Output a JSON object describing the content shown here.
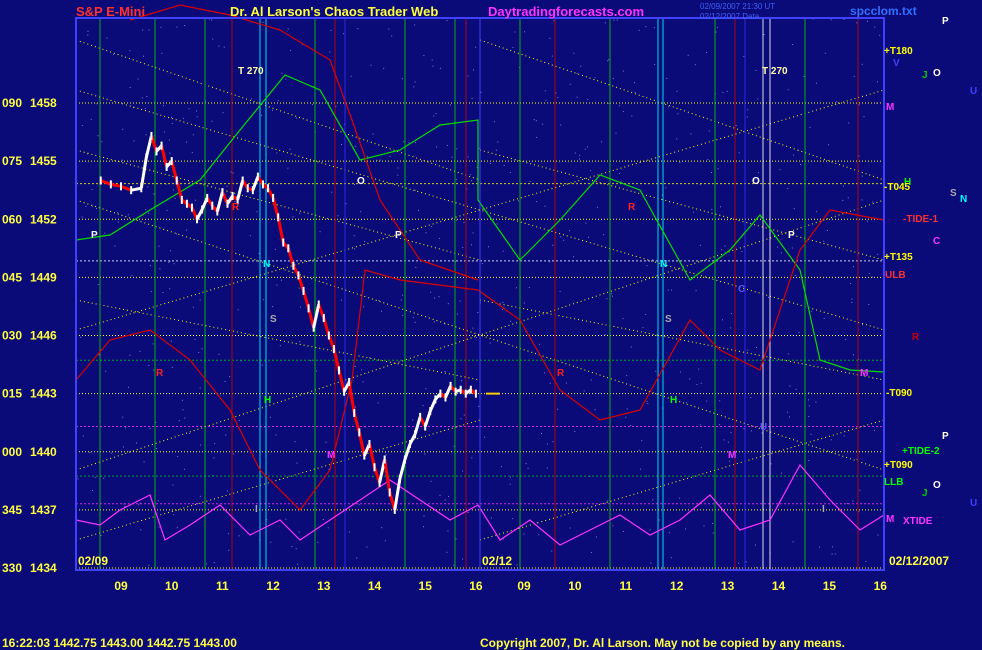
{
  "header": {
    "instrument": "S&P E-Mini",
    "site_title": "Dr. Al Larson's Chaos Trader Web",
    "site_url": "Daytradingforecasts.com",
    "stamp_line1": "02/09/2007 21:30 UT",
    "stamp_line2": "02/12/2007 Data",
    "file_name": "spcclom.txt"
  },
  "footer": {
    "quote_line": "16:22:03  1442.75  1443.00  1442.75  1443.00",
    "copyright": "Copyright 2007, Dr. Al Larson. May not be copied by any means."
  },
  "colors": {
    "background": "#0a0a78",
    "price_bar_up": "#ffffff",
    "price_bar_down": "#ff0000",
    "grid_dotted": "#ffff00",
    "vertical_green": "#00cc00",
    "vertical_red": "#cc0000",
    "vertical_cyan": "#00ffff",
    "vertical_blue": "#3030ff",
    "tide_green": "#00dd00",
    "tide_red": "#dd0000",
    "xtide_magenta": "#ff33ff",
    "axis_blue": "#4040ff"
  },
  "chart_data": {
    "type": "line",
    "title": "S&P E-Mini",
    "y_labels": [
      {
        "angle": "090",
        "price": "1458",
        "value": 1458
      },
      {
        "angle": "075",
        "price": "1455",
        "value": 1455
      },
      {
        "angle": "060",
        "price": "1452",
        "value": 1452
      },
      {
        "angle": "045",
        "price": "1449",
        "value": 1449
      },
      {
        "angle": "030",
        "price": "1446",
        "value": 1446
      },
      {
        "angle": "015",
        "price": "1443",
        "value": 1443
      },
      {
        "angle": "000",
        "price": "1440",
        "value": 1440
      },
      {
        "angle": "345",
        "price": "1437",
        "value": 1437
      },
      {
        "angle": "330",
        "price": "1434",
        "value": 1434
      }
    ],
    "ylim": [
      1434,
      1458
    ],
    "day1_date": "02/09",
    "day2_date": "02/12",
    "end_date": "02/12/2007",
    "day1_hours": [
      "09",
      "10",
      "11",
      "12",
      "13",
      "14",
      "15",
      "16"
    ],
    "day2_hours": [
      "09",
      "10",
      "11",
      "12",
      "13",
      "14",
      "15",
      "16"
    ],
    "price_series": {
      "name": "S&P E-Mini 02/09",
      "x_hours": [
        8.6,
        8.8,
        9.0,
        9.2,
        9.4,
        9.5,
        9.6,
        9.7,
        9.8,
        9.9,
        10.0,
        10.1,
        10.2,
        10.3,
        10.4,
        10.5,
        10.6,
        10.7,
        10.8,
        10.9,
        11.0,
        11.1,
        11.2,
        11.3,
        11.4,
        11.5,
        11.6,
        11.7,
        11.8,
        11.9,
        12.0,
        12.1,
        12.2,
        12.3,
        12.4,
        12.5,
        12.6,
        12.7,
        12.8,
        12.9,
        13.0,
        13.1,
        13.2,
        13.3,
        13.4,
        13.5,
        13.6,
        13.7,
        13.8,
        13.9,
        14.0,
        14.1,
        14.2,
        14.3,
        14.4,
        14.5,
        14.6,
        14.7,
        14.8,
        14.9,
        15.0,
        15.1,
        15.2,
        15.3,
        15.4,
        15.5,
        15.6,
        15.7,
        15.8,
        15.9,
        16.0
      ],
      "values": [
        1454.0,
        1453.8,
        1453.7,
        1453.5,
        1453.6,
        1455.2,
        1456.3,
        1455.5,
        1455.8,
        1454.7,
        1455.0,
        1454.0,
        1453.0,
        1452.8,
        1452.6,
        1452.0,
        1452.5,
        1453.1,
        1452.7,
        1452.4,
        1453.4,
        1452.8,
        1453.2,
        1453.0,
        1454.0,
        1453.6,
        1453.5,
        1454.2,
        1453.8,
        1453.6,
        1453.1,
        1452.1,
        1450.8,
        1450.5,
        1449.6,
        1449.1,
        1448.3,
        1447.4,
        1446.4,
        1447.6,
        1446.9,
        1446.0,
        1445.3,
        1444.2,
        1443.1,
        1443.6,
        1442.0,
        1441.0,
        1439.8,
        1440.4,
        1439.2,
        1438.4,
        1439.6,
        1437.9,
        1437.0,
        1438.6,
        1439.6,
        1440.4,
        1440.9,
        1441.8,
        1441.3,
        1442.1,
        1442.7,
        1443.0,
        1442.8,
        1443.4,
        1443.1,
        1443.2,
        1443.0,
        1443.2,
        1443.0
      ]
    },
    "last_price": 1443.0,
    "markers_left": [
      {
        "label": "T 270",
        "color": "#ffffaa"
      },
      {
        "label": "O",
        "color": "#ffffff"
      },
      {
        "label": "P",
        "color": "#ffffff"
      },
      {
        "label": "P",
        "color": "#ffffff"
      },
      {
        "label": "N",
        "color": "#00ffff"
      },
      {
        "label": "S",
        "color": "#aaaaaa"
      },
      {
        "label": "R",
        "color": "#ff2020"
      },
      {
        "label": "R",
        "color": "#ff2020"
      },
      {
        "label": "H",
        "color": "#00ff00"
      },
      {
        "label": "M",
        "color": "#ff33ff"
      },
      {
        "label": "I",
        "color": "#aaaaaa"
      }
    ],
    "markers_right": [
      {
        "label": "T 270",
        "color": "#ffffaa"
      },
      {
        "label": "O",
        "color": "#ffffff"
      },
      {
        "label": "P",
        "color": "#ffffff"
      },
      {
        "label": "N",
        "color": "#00ffff"
      },
      {
        "label": "S",
        "color": "#aaaaaa"
      },
      {
        "label": "R",
        "color": "#ff2020"
      },
      {
        "label": "R",
        "color": "#ff2020"
      },
      {
        "label": "H",
        "color": "#00ff00"
      },
      {
        "label": "M",
        "color": "#ff33ff"
      },
      {
        "label": "M",
        "color": "#ff33ff"
      },
      {
        "label": "I",
        "color": "#aaaaaa"
      },
      {
        "label": "C",
        "color": "#5555ff"
      },
      {
        "label": "U",
        "color": "#5555ff"
      }
    ],
    "legend": [
      {
        "label": "+T180",
        "color": "#ffff00"
      },
      {
        "label": "V",
        "color": "#4040ff"
      },
      {
        "label": "J",
        "color": "#00cc00"
      },
      {
        "label": "O",
        "color": "#ffffff"
      },
      {
        "label": "P",
        "color": "#ffffff"
      },
      {
        "label": "U",
        "color": "#4040ff"
      },
      {
        "label": "M",
        "color": "#ff33ff"
      },
      {
        "label": "H",
        "color": "#00ff00"
      },
      {
        "label": "-T045",
        "color": "#ffff00"
      },
      {
        "label": "S",
        "color": "#aaaaaa"
      },
      {
        "label": "N",
        "color": "#00ffff"
      },
      {
        "label": "-TIDE-1",
        "color": "#ff3030"
      },
      {
        "label": "C",
        "color": "#ff33ff"
      },
      {
        "label": "+T135",
        "color": "#ffff00"
      },
      {
        "label": "ULB",
        "color": "#ff3030"
      },
      {
        "label": "R",
        "color": "#cc0000"
      },
      {
        "label": "-T090",
        "color": "#ffff00"
      },
      {
        "label": "P",
        "color": "#ffffff"
      },
      {
        "label": "+TIDE-2",
        "color": "#00ff00"
      },
      {
        "label": "+T090",
        "color": "#ffff00"
      },
      {
        "label": "LLB",
        "color": "#00ff00"
      },
      {
        "label": "O",
        "color": "#ffffff"
      },
      {
        "label": "J",
        "color": "#00cc00"
      },
      {
        "label": "U",
        "color": "#4040ff"
      },
      {
        "label": "M",
        "color": "#ff33ff"
      },
      {
        "label": "XTIDE",
        "color": "#ff33ff"
      }
    ]
  }
}
